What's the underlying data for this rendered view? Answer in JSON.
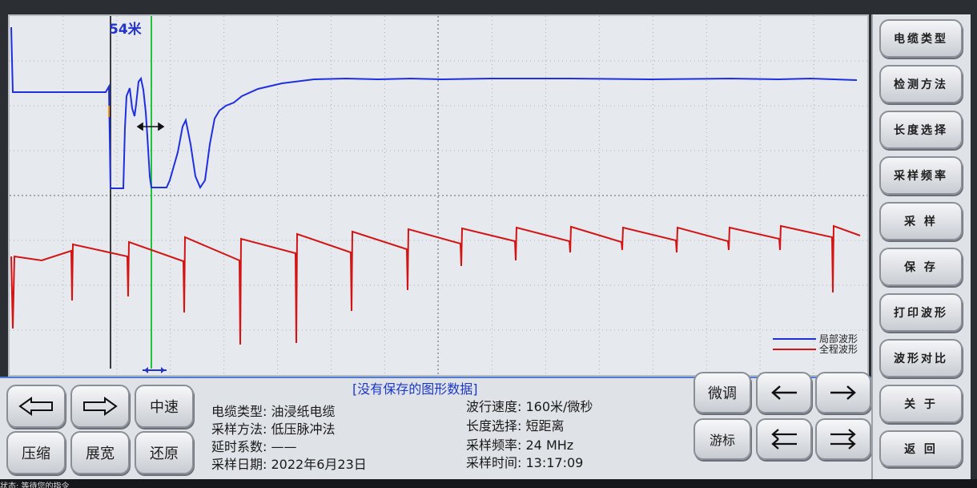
{
  "plot": {
    "cursor_label": "54米",
    "legend": [
      {
        "label": "局部波形",
        "color": "#1f2fe0"
      },
      {
        "label": "全程波形",
        "color": "#d21414"
      }
    ]
  },
  "status_message": "[没有保存的图形数据]",
  "left_buttons": {
    "left_arrow_icon": "left-arrow",
    "right_arrow_icon": "right-arrow",
    "speed_label": "中速",
    "compress_label": "压缩",
    "expand_label": "展宽",
    "restore_label": "还原"
  },
  "info": {
    "cable_type_label": "电缆类型:",
    "cable_type_value": "油浸纸电缆",
    "method_label": "采样方法:",
    "method_value": "低压脉冲法",
    "delay_label": "延时系数:",
    "delay_value": "——",
    "date_label": "采样日期:",
    "date_value": "2022年6月23日",
    "speed_label": "波行速度:",
    "speed_value": "160米/微秒",
    "length_label": "长度选择:",
    "length_value": "短距离",
    "freq_label": "采样频率:",
    "freq_value": "24 MHz",
    "time_label": "采样时间:",
    "time_value": "13:17:09"
  },
  "right_buttons": {
    "fine_tune_label": "微调",
    "cursor_label": "游标"
  },
  "menu": [
    "电缆类型",
    "检测方法",
    "长度选择",
    "采样频率",
    "采 样",
    "保 存",
    "打印波形",
    "波形对比",
    "关 于",
    "返 回"
  ],
  "footer_text": "状态: 等待您的指令",
  "colors": {
    "blue_trace": "#1f2fe0",
    "red_trace": "#d21414",
    "cursor_green": "#22c33a",
    "accent_text": "#1b38c9"
  }
}
